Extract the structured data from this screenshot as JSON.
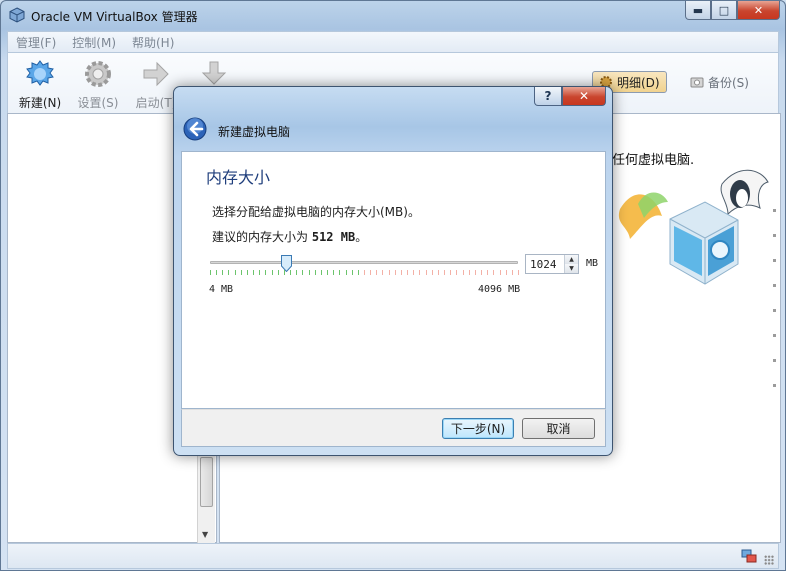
{
  "window": {
    "title": "Oracle VM VirtualBox 管理器",
    "min": "▬",
    "max": "□",
    "close": "✕"
  },
  "menu": [
    "管理(F)",
    "控制(M)",
    "帮助(H)"
  ],
  "toolbar": {
    "new": "新建(N)",
    "settings": "设置(S)",
    "start": "启动(T)",
    "discard": "丢弃"
  },
  "segments": {
    "details": "明细(D)",
    "snapshots": "备份(S)"
  },
  "welcome": {
    "text": "任何虚拟电脑."
  },
  "dialog": {
    "help": "?",
    "close": "✕",
    "title": "新建虚拟电脑",
    "page_title": "内存大小",
    "description": "选择分配给虚拟电脑的内存大小(MB)。",
    "recommend_prefix": "建议的内存大小为",
    "recommend_value": "512 MB",
    "recommend_suffix": "。",
    "memory": {
      "min_label": "4 MB",
      "max_label": "4096 MB",
      "min": 4,
      "max": 4096,
      "value": "1024",
      "unit": "MB"
    },
    "buttons": {
      "next": "下一步(N)",
      "cancel": "取消"
    }
  },
  "colors": {
    "accent": "#1f3e7c",
    "tick_ok": "#6cc46c",
    "tick_warn": "#f3b0a6"
  }
}
